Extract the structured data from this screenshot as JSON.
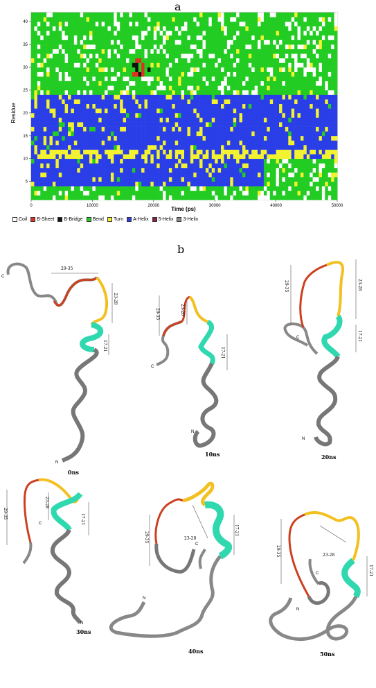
{
  "panel_a": {
    "label": "a",
    "chart_data": {
      "type": "heatmap",
      "title": "",
      "xlabel": "Time (ps)",
      "ylabel": "Residue",
      "xlim": [
        0,
        50000
      ],
      "ylim": [
        1,
        42
      ],
      "x_ticks": [
        "0",
        "10000",
        "20000",
        "30000",
        "40000",
        "50000"
      ],
      "y_ticks": [
        "5",
        "10",
        "15",
        "20",
        "25",
        "30",
        "35",
        "40"
      ],
      "categories": [
        "Coil",
        "B-Sheet",
        "B-Bridge",
        "Bend",
        "Turn",
        "A-Helix",
        "5-Helix",
        "3-Helix"
      ],
      "colors": {
        "Coil": "#ffffff",
        "B-Sheet": "#e03020",
        "B-Bridge": "#111111",
        "Bend": "#22cc22",
        "Turn": "#f2f230",
        "A-Helix": "#2a3ee8",
        "5-Helix": "#8a2040",
        "3-Helix": "#8a8a8a"
      },
      "residue_blocks": [
        {
          "from": 1,
          "to": 3,
          "dominant": "Bend"
        },
        {
          "from": 4,
          "to": 9,
          "dominant": "A-Helix",
          "after_time": 38000,
          "then": "Bend"
        },
        {
          "from": 10,
          "to": 11,
          "dominant": "Turn"
        },
        {
          "from": 12,
          "to": 23,
          "dominant": "A-Helix"
        },
        {
          "from": 24,
          "to": 26,
          "dominant": "Bend"
        },
        {
          "from": 27,
          "to": 41,
          "dominant": "Bend"
        }
      ]
    },
    "legend": [
      "Coil",
      "B-Sheet",
      "B-Bridge",
      "Bend",
      "Turn",
      "A-Helix",
      "5-Helix",
      "3-Helix"
    ]
  },
  "panel_b": {
    "label": "b",
    "structures": [
      {
        "time": "0ns",
        "termini": [
          "C",
          "N"
        ],
        "segments": [
          "29-35",
          "23-28",
          "17-21"
        ]
      },
      {
        "time": "10ns",
        "termini": [
          "C",
          "N"
        ],
        "segments": [
          "29-35",
          "23-28",
          "17-21"
        ]
      },
      {
        "time": "20ns",
        "termini": [
          "C",
          "N"
        ],
        "segments": [
          "29-35",
          "23-28",
          "17-21"
        ]
      },
      {
        "time": "30ns",
        "termini": [
          "C",
          "N"
        ],
        "segments": [
          "29-35",
          "23-28",
          "17-21"
        ]
      },
      {
        "time": "40ns",
        "termini": [
          "C",
          "N"
        ],
        "segments": [
          "29-35",
          "23-28",
          "17-21"
        ]
      },
      {
        "time": "50ns",
        "termini": [
          "C",
          "N"
        ],
        "segments": [
          "29-35",
          "23-28",
          "17-21"
        ]
      }
    ]
  }
}
